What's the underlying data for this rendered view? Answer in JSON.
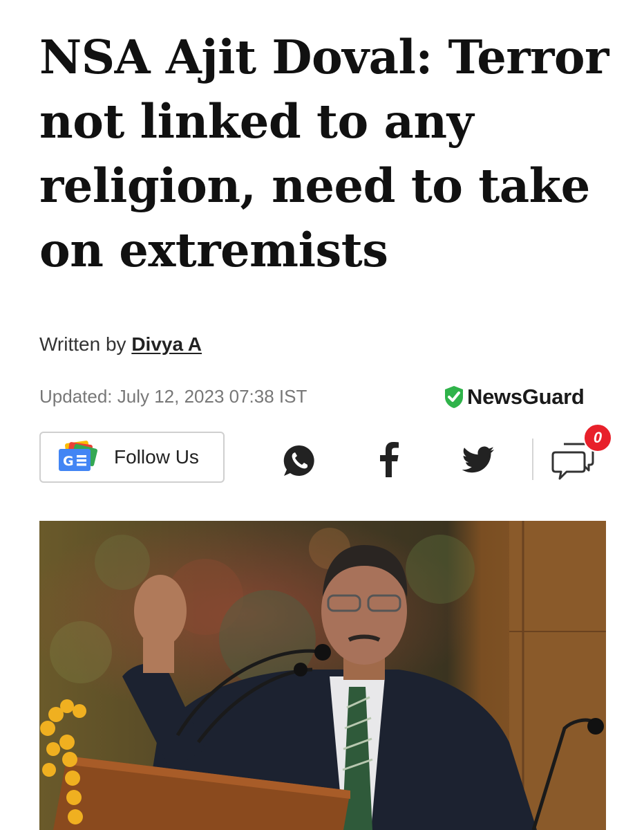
{
  "article": {
    "headline": "NSA Ajit Doval: Terror not linked to any religion, need to take on extremists",
    "byline_prefix": "Written by",
    "author": "Divya A",
    "updated": "Updated: July 12, 2023 07:38 IST"
  },
  "newsguard": {
    "label": "NewsGuard",
    "icon": "shield-check-icon",
    "color": "#2fb34a"
  },
  "follow": {
    "label": "Follow Us",
    "icon": "google-news-icon"
  },
  "share": {
    "icons": [
      "whatsapp-icon",
      "facebook-icon",
      "twitter-icon",
      "comments-icon"
    ],
    "comment_count": "0"
  },
  "image": {
    "subject": "man-speaking-at-podium-photo"
  },
  "colors": {
    "badge": "#e8202a",
    "text": "#111111",
    "muted": "#777777"
  }
}
